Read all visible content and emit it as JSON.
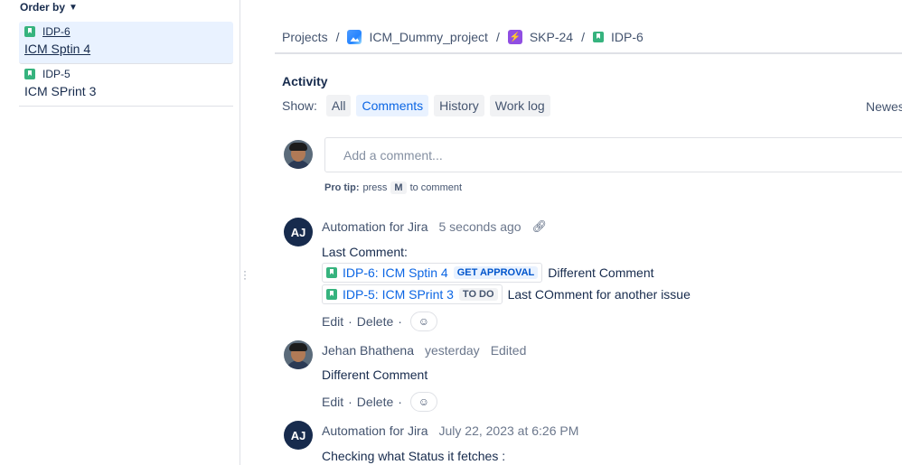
{
  "sidebar": {
    "order_by": "Order by",
    "issues": [
      {
        "key": "IDP-6",
        "summary": "ICM Sptin 4",
        "selected": true
      },
      {
        "key": "IDP-5",
        "summary": "ICM SPrint 3",
        "selected": false
      }
    ]
  },
  "breadcrumb": {
    "projects": "Projects",
    "project": "ICM_Dummy_project",
    "epic": "SKP-24",
    "issue": "IDP-6",
    "separator": "/"
  },
  "activity": {
    "title": "Activity",
    "show_label": "Show:",
    "filters": [
      "All",
      "Comments",
      "History",
      "Work log"
    ],
    "active_filter": "Comments",
    "sort_label": "Newest first"
  },
  "comment_box": {
    "placeholder": "Add a comment...",
    "protip_label": "Pro tip:",
    "protip_press": "press",
    "protip_key": "M",
    "protip_suffix": "to comment"
  },
  "comments": [
    {
      "avatar_initials": "AJ",
      "author": "Automation for Jira",
      "time": "5 seconds ago",
      "body": "Last Comment:",
      "issues": [
        {
          "key_summary": "IDP-6: ICM Sptin 4",
          "status": "GET APPROVAL",
          "text": "Different Comment"
        },
        {
          "key_summary": "IDP-5: ICM SPrint 3",
          "status": "TO DO",
          "text": "Last COmment for another issue"
        }
      ],
      "edit": "Edit",
      "delete": "Delete",
      "dot": "·"
    },
    {
      "author": "Jehan Bhathena",
      "time": "yesterday",
      "edited": "Edited",
      "body": "Different Comment",
      "edit": "Edit",
      "delete": "Delete",
      "dot": "·"
    },
    {
      "avatar_initials": "AJ",
      "author": "Automation for Jira",
      "time": "July 22, 2023 at 6:26 PM",
      "body": "Checking what Status it fetches :"
    }
  ],
  "icons": {
    "story": "story-icon",
    "project": "project-icon",
    "epic": "epic-icon",
    "link": "link-icon",
    "reaction": "add-reaction-icon",
    "chevron": "chevron-down-icon"
  },
  "colors": {
    "accent": "#0c66e4",
    "selected_bg": "#e9f2ff",
    "story_green": "#36b37e",
    "epic_purple": "#904ee2"
  }
}
